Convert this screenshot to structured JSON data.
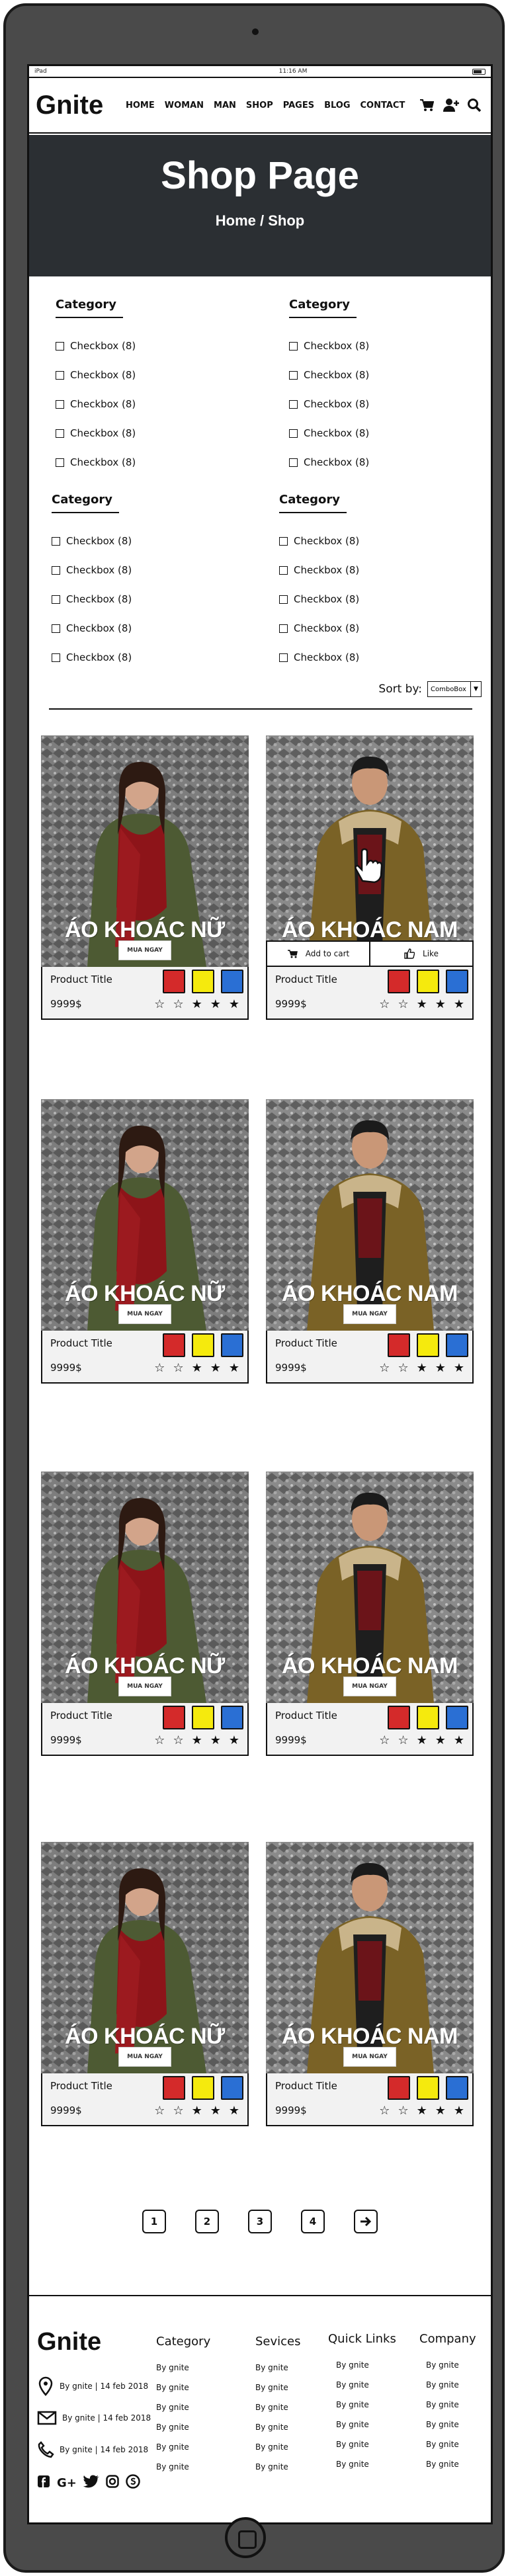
{
  "status_bar": {
    "carrier": "iPad",
    "time": "11:16 AM"
  },
  "header": {
    "logo": "Gnite",
    "nav": [
      "HOME",
      "WOMAN",
      "MAN",
      "SHOP",
      "PAGES",
      "BLOG",
      "CONTACT"
    ],
    "icons": [
      "cart-icon",
      "add-user-icon",
      "search-icon"
    ]
  },
  "hero": {
    "title": "Shop Page",
    "breadcrumb": "Home / Shop"
  },
  "filters": {
    "blocks": [
      {
        "title": "Category",
        "items": [
          "Checkbox (8)",
          "Checkbox (8)",
          "Checkbox (8)",
          "Checkbox (8)",
          "Checkbox (8)"
        ]
      },
      {
        "title": "Category",
        "items": [
          "Checkbox (8)",
          "Checkbox (8)",
          "Checkbox (8)",
          "Checkbox (8)",
          "Checkbox (8)"
        ]
      },
      {
        "title": "Category",
        "items": [
          "Checkbox (8)",
          "Checkbox (8)",
          "Checkbox (8)",
          "Checkbox (8)",
          "Checkbox (8)"
        ]
      },
      {
        "title": "Category",
        "items": [
          "Checkbox (8)",
          "Checkbox (8)",
          "Checkbox (8)",
          "Checkbox (8)",
          "Checkbox (8)"
        ]
      }
    ],
    "sort_label": "Sort by:",
    "sort_value": "ComboBox"
  },
  "products": [
    {
      "caption": "ÁO KHOÁC NỮ",
      "buy_label": "MUA NGAY",
      "title": "Product Title",
      "price": "9999$",
      "filled_stars": 3,
      "hovered": false
    },
    {
      "caption": "ÁO KHOÁC NAM",
      "buy_label": "MUA NGAY",
      "title": "Product Title",
      "price": "9999$",
      "filled_stars": 3,
      "hovered": true
    },
    {
      "caption": "ÁO KHOÁC NỮ",
      "buy_label": "MUA NGAY",
      "title": "Product Title",
      "price": "9999$",
      "filled_stars": 3,
      "hovered": false
    },
    {
      "caption": "ÁO KHOÁC NAM",
      "buy_label": "MUA NGAY",
      "title": "Product Title",
      "price": "9999$",
      "filled_stars": 3,
      "hovered": false
    },
    {
      "caption": "ÁO KHOÁC NỮ",
      "buy_label": "MUA NGAY",
      "title": "Product Title",
      "price": "9999$",
      "filled_stars": 3,
      "hovered": false
    },
    {
      "caption": "ÁO KHOÁC NAM",
      "buy_label": "MUA NGAY",
      "title": "Product Title",
      "price": "9999$",
      "filled_stars": 3,
      "hovered": false
    },
    {
      "caption": "ÁO KHOÁC NỮ",
      "buy_label": "MUA NGAY",
      "title": "Product Title",
      "price": "9999$",
      "filled_stars": 3,
      "hovered": false
    },
    {
      "caption": "ÁO KHOÁC NAM",
      "buy_label": "MUA NGAY",
      "title": "Product Title",
      "price": "9999$",
      "filled_stars": 3,
      "hovered": false
    }
  ],
  "swatch_colors": [
    "#d42a2a",
    "#f5ea0d",
    "#2a6fd4"
  ],
  "hover_actions": {
    "add_to_cart": "Add to cart",
    "like": "Like"
  },
  "pagination": {
    "pages": [
      "1",
      "2",
      "3",
      "4"
    ],
    "next_icon": "arrow-right-icon"
  },
  "footer": {
    "logo": "Gnite",
    "contact": [
      "By gnite | 14 feb 2018",
      "By gnite | 14 feb 2018",
      "By gnite | 14 feb 2018"
    ],
    "social": [
      "f",
      "G+",
      "twitter",
      "instagram",
      "skype"
    ],
    "columns": [
      {
        "title": "Category",
        "links": [
          "By gnite",
          "By gnite",
          "By gnite",
          "By gnite",
          "By gnite",
          "By gnite"
        ]
      },
      {
        "title": "Sevices",
        "links": [
          "By gnite",
          "By gnite",
          "By gnite",
          "By gnite",
          "By gnite",
          "By gnite"
        ]
      },
      {
        "title": "Quick Links",
        "links": [
          "By gnite",
          "By gnite",
          "By gnite",
          "By gnite",
          "By gnite",
          "By gnite"
        ]
      },
      {
        "title": "Company",
        "links": [
          "By gnite",
          "By gnite",
          "By gnite",
          "By gnite",
          "By gnite",
          "By gnite"
        ]
      }
    ]
  }
}
